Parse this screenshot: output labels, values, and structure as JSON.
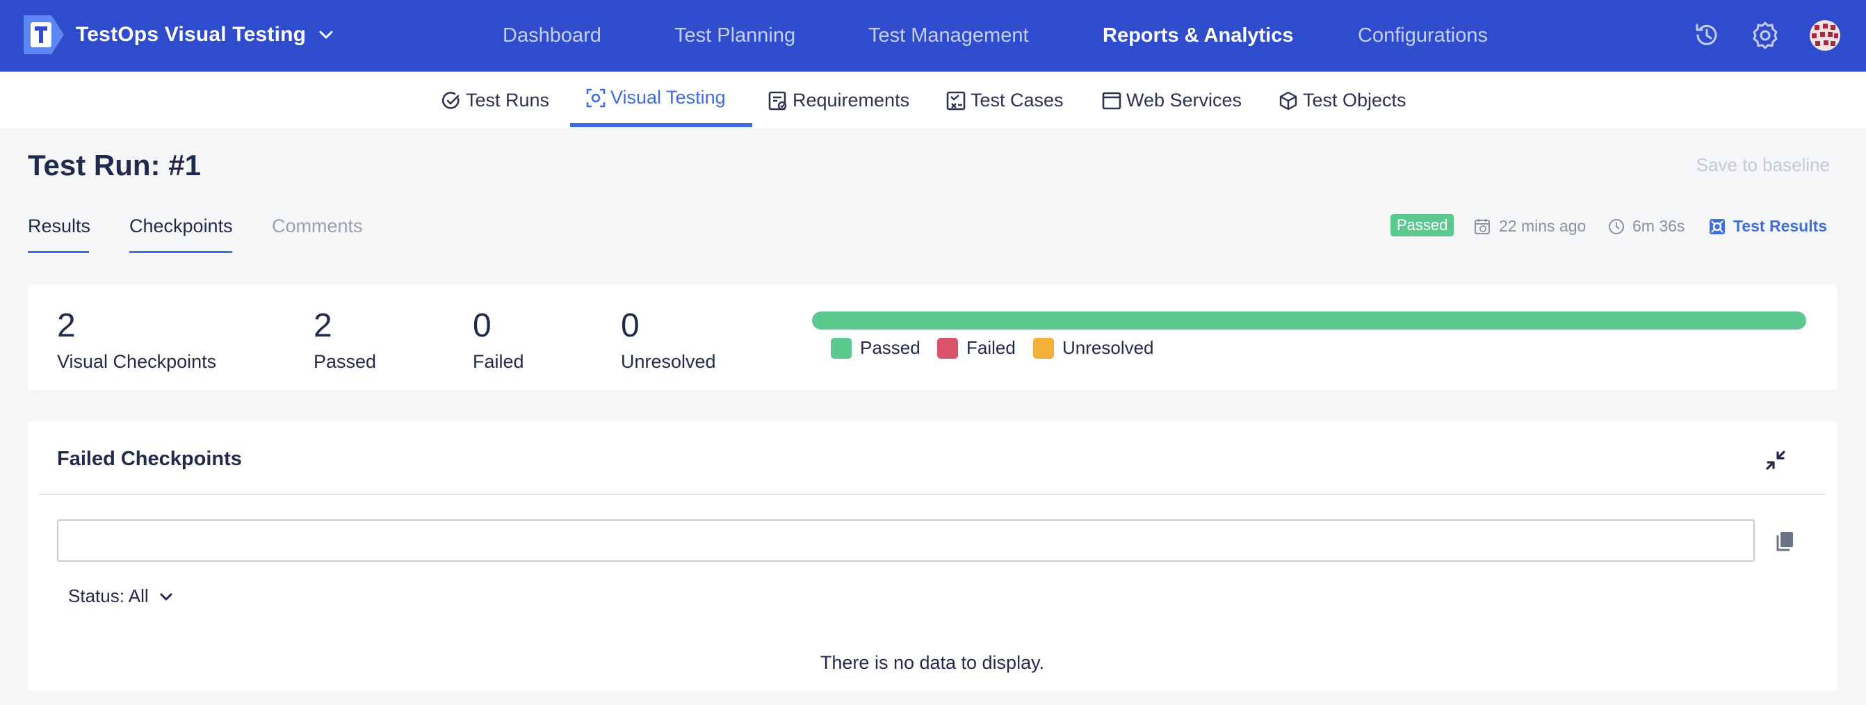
{
  "app": {
    "name": "TestOps Visual Testing"
  },
  "main_nav": [
    "Dashboard",
    "Test Planning",
    "Test Management",
    "Reports & Analytics",
    "Configurations"
  ],
  "sub_nav": [
    "Test Runs",
    "Visual Testing",
    "Requirements",
    "Test Cases",
    "Web Services",
    "Test Objects"
  ],
  "page": {
    "title": "Test Run: #1",
    "save_label": "Save to baseline"
  },
  "tabs": [
    "Results",
    "Checkpoints",
    "Comments"
  ],
  "meta": {
    "status": "Passed",
    "time_ago": "22 mins ago",
    "duration": "6m 36s",
    "link": "Test Results"
  },
  "stats": [
    {
      "value": "2",
      "label": "Visual Checkpoints"
    },
    {
      "value": "2",
      "label": "Passed"
    },
    {
      "value": "0",
      "label": "Failed"
    },
    {
      "value": "0",
      "label": "Unresolved"
    }
  ],
  "progress": {
    "passed_fraction": 1.0
  },
  "legend": [
    {
      "label": "Passed",
      "color": "#5ac88f"
    },
    {
      "label": "Failed",
      "color": "#d9546a"
    },
    {
      "label": "Unresolved",
      "color": "#f2b03a"
    }
  ],
  "failed_panel": {
    "title": "Failed Checkpoints",
    "search_value": "",
    "status_filter": "Status: All",
    "empty_message": "There is no data to display."
  },
  "colors": {
    "header_bg": "#2e4ccc",
    "accent": "#3f6ee0",
    "passed": "#5ac88f"
  }
}
